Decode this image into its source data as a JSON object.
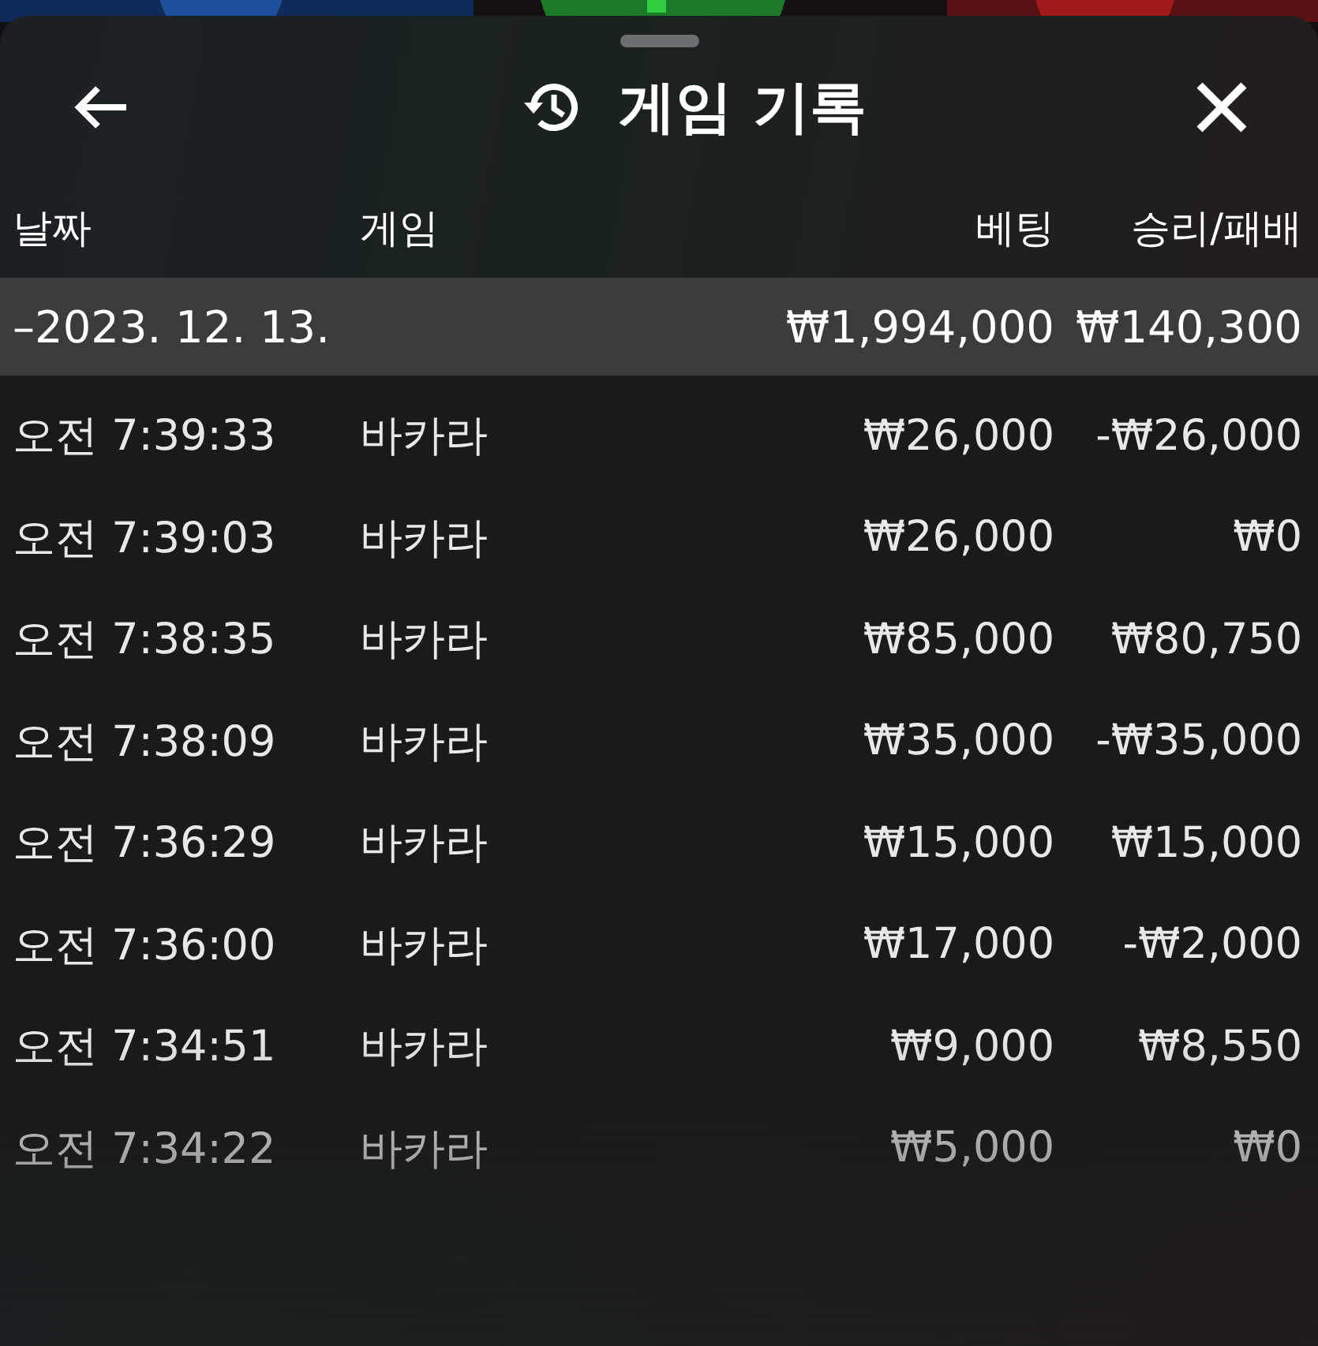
{
  "header": {
    "title": "게임 기록"
  },
  "columns": [
    "날짜",
    "게임",
    "베팅",
    "승리/패배"
  ],
  "date_group": {
    "date": "–2023. 12. 13.",
    "bet": "₩1,994,000",
    "result": "₩140,300"
  },
  "rows": [
    {
      "time": "오전 7:39:33",
      "game": "바카라",
      "bet": "₩26,000",
      "result": "-₩26,000"
    },
    {
      "time": "오전 7:39:03",
      "game": "바카라",
      "bet": "₩26,000",
      "result": "₩0"
    },
    {
      "time": "오전 7:38:35",
      "game": "바카라",
      "bet": "₩85,000",
      "result": "₩80,750"
    },
    {
      "time": "오전 7:38:09",
      "game": "바카라",
      "bet": "₩35,000",
      "result": "-₩35,000"
    },
    {
      "time": "오전 7:36:29",
      "game": "바카라",
      "bet": "₩15,000",
      "result": "₩15,000"
    },
    {
      "time": "오전 7:36:00",
      "game": "바카라",
      "bet": "₩17,000",
      "result": "-₩2,000"
    },
    {
      "time": "오전 7:34:51",
      "game": "바카라",
      "bet": "₩9,000",
      "result": "₩8,550"
    },
    {
      "time": "오전 7:34:22",
      "game": "바카라",
      "bet": "₩5,000",
      "result": "₩0"
    }
  ]
}
